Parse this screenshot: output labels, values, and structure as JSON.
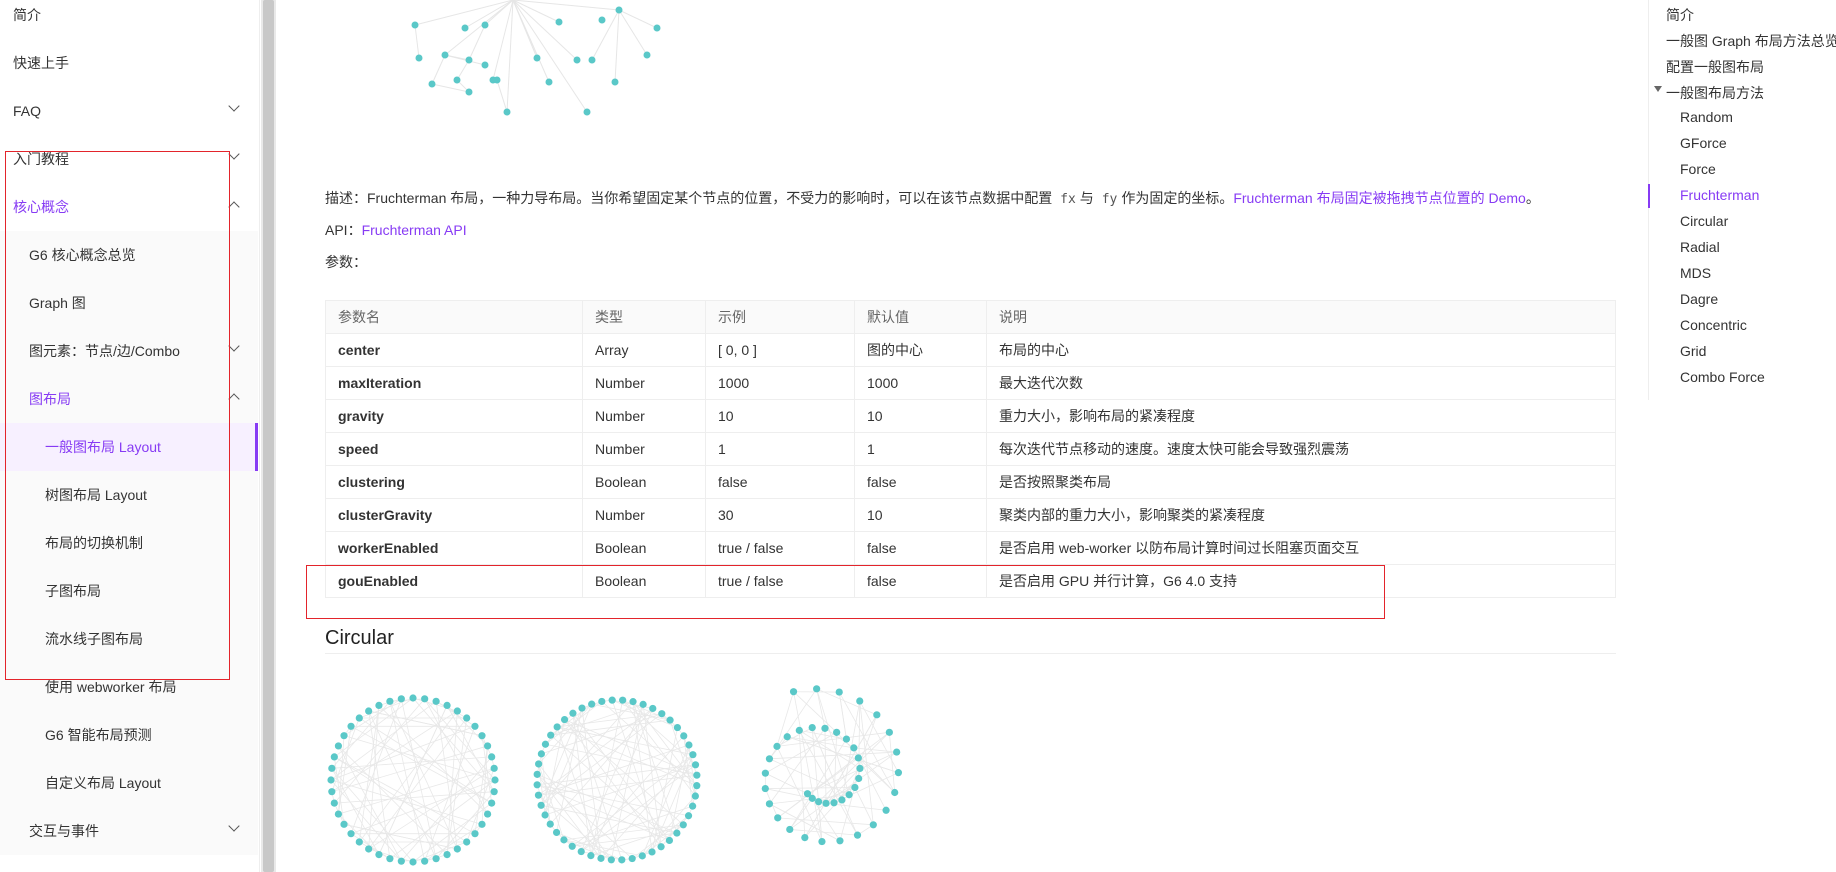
{
  "sidebar": {
    "items": [
      {
        "label": "简介"
      },
      {
        "label": "快速上手"
      },
      {
        "label": "FAQ"
      },
      {
        "label": "入门教程"
      },
      {
        "label": "核心概念"
      },
      {
        "label": "G6 核心概念总览"
      },
      {
        "label": "Graph 图"
      },
      {
        "label": "图元素：节点/边/Combo"
      },
      {
        "label": "图布局"
      },
      {
        "label": "一般图布局 Layout"
      },
      {
        "label": "树图布局 Layout"
      },
      {
        "label": "布局的切换机制"
      },
      {
        "label": "子图布局"
      },
      {
        "label": "流水线子图布局"
      },
      {
        "label": "使用 webworker 布局"
      },
      {
        "label": "G6 智能布局预测"
      },
      {
        "label": "自定义布局 Layout"
      },
      {
        "label": "交互与事件"
      }
    ]
  },
  "content": {
    "desc": {
      "prefix": "描述：Fruchterman 布局，一种力导布局。当你希望固定某个节点的位置，不受力的影响时，可以在该节点数据中配置",
      "code_fx": "fx",
      "and": "与",
      "code_fy": "fy",
      "suffix": "作为固定的坐标。",
      "link": "Fruchterman 布局固定被拖拽节点位置的 Demo",
      "end": "。"
    },
    "api": {
      "label": "API：",
      "link": "Fruchterman API"
    },
    "params_label": "参数：",
    "circular_title": "Circular"
  },
  "table": {
    "headers": [
      "参数名",
      "类型",
      "示例",
      "默认值",
      "说明"
    ],
    "rows": [
      [
        "center",
        "Array",
        "[ 0, 0 ]",
        "图的中心",
        "布局的中心"
      ],
      [
        "maxIteration",
        "Number",
        "1000",
        "1000",
        "最大迭代次数"
      ],
      [
        "gravity",
        "Number",
        "10",
        "10",
        "重力大小，影响布局的紧凑程度"
      ],
      [
        "speed",
        "Number",
        "1",
        "1",
        "每次迭代节点移动的速度。速度太快可能会导致强烈震荡"
      ],
      [
        "clustering",
        "Boolean",
        "false",
        "false",
        "是否按照聚类布局"
      ],
      [
        "clusterGravity",
        "Number",
        "30",
        "10",
        "聚类内部的重力大小，影响聚类的紧凑程度"
      ],
      [
        "workerEnabled",
        "Boolean",
        "true / false",
        "false",
        "是否启用 web-worker 以防布局计算时间过长阻塞页面交互"
      ],
      [
        "gouEnabled",
        "Boolean",
        "true / false",
        "false",
        "是否启用 GPU 并行计算，G6 4.0 支持"
      ]
    ]
  },
  "toc": {
    "items": [
      {
        "label": "简介"
      },
      {
        "label": "一般图 Graph 布局方法总览"
      },
      {
        "label": "配置一般图布局"
      },
      {
        "label": "一般图布局方法"
      },
      {
        "label": "Random"
      },
      {
        "label": "GForce"
      },
      {
        "label": "Force"
      },
      {
        "label": "Fruchterman"
      },
      {
        "label": "Circular"
      },
      {
        "label": "Radial"
      },
      {
        "label": "MDS"
      },
      {
        "label": "Dagre"
      },
      {
        "label": "Concentric"
      },
      {
        "label": "Grid"
      },
      {
        "label": "Combo Force"
      }
    ]
  },
  "colors": {
    "accent": "#873bf4",
    "node": "#5ac8c8",
    "highlight_box": "#e3242b"
  }
}
